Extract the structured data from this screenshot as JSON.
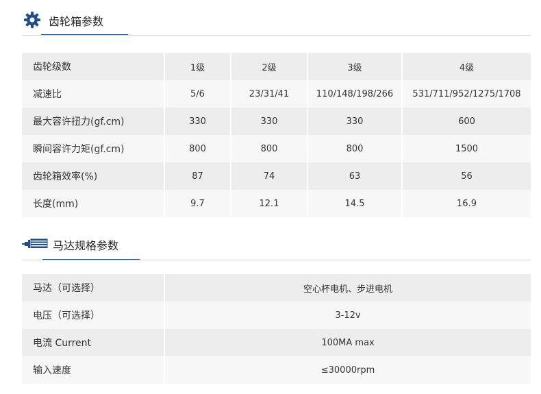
{
  "gearbox": {
    "title": "齿轮箱参数",
    "rows": [
      [
        "齿轮级数",
        "1级",
        "2级",
        "3级",
        "4级"
      ],
      [
        "减速比",
        "5/6",
        "23/31/41",
        "110/148/198/266",
        "531/711/952/1275/1708"
      ],
      [
        "最大容许扭力(gf.cm)",
        "330",
        "330",
        "330",
        "600"
      ],
      [
        "瞬间容许力矩(gf.cm)",
        "800",
        "800",
        "800",
        "1500"
      ],
      [
        "齿轮箱效率(%)",
        "87",
        "74",
        "63",
        "56"
      ],
      [
        "长度(mm)",
        "9.7",
        "12.1",
        "14.5",
        "16.9"
      ]
    ]
  },
  "motor": {
    "title": "马达规格参数",
    "rows": [
      [
        "马达（可选择）",
        "空心杯电机、步进电机"
      ],
      [
        "电压（可选择）",
        "3-12v"
      ],
      [
        "电流  Current",
        "100MA max"
      ],
      [
        "输入速度",
        "≤30000rpm"
      ]
    ]
  },
  "colors": {
    "accent": "#1f4e8c",
    "row_dark": "#ededed",
    "row_light": "#f7f7f7"
  },
  "icons": {
    "gearbox": "gear-icon",
    "motor": "motor-icon"
  }
}
